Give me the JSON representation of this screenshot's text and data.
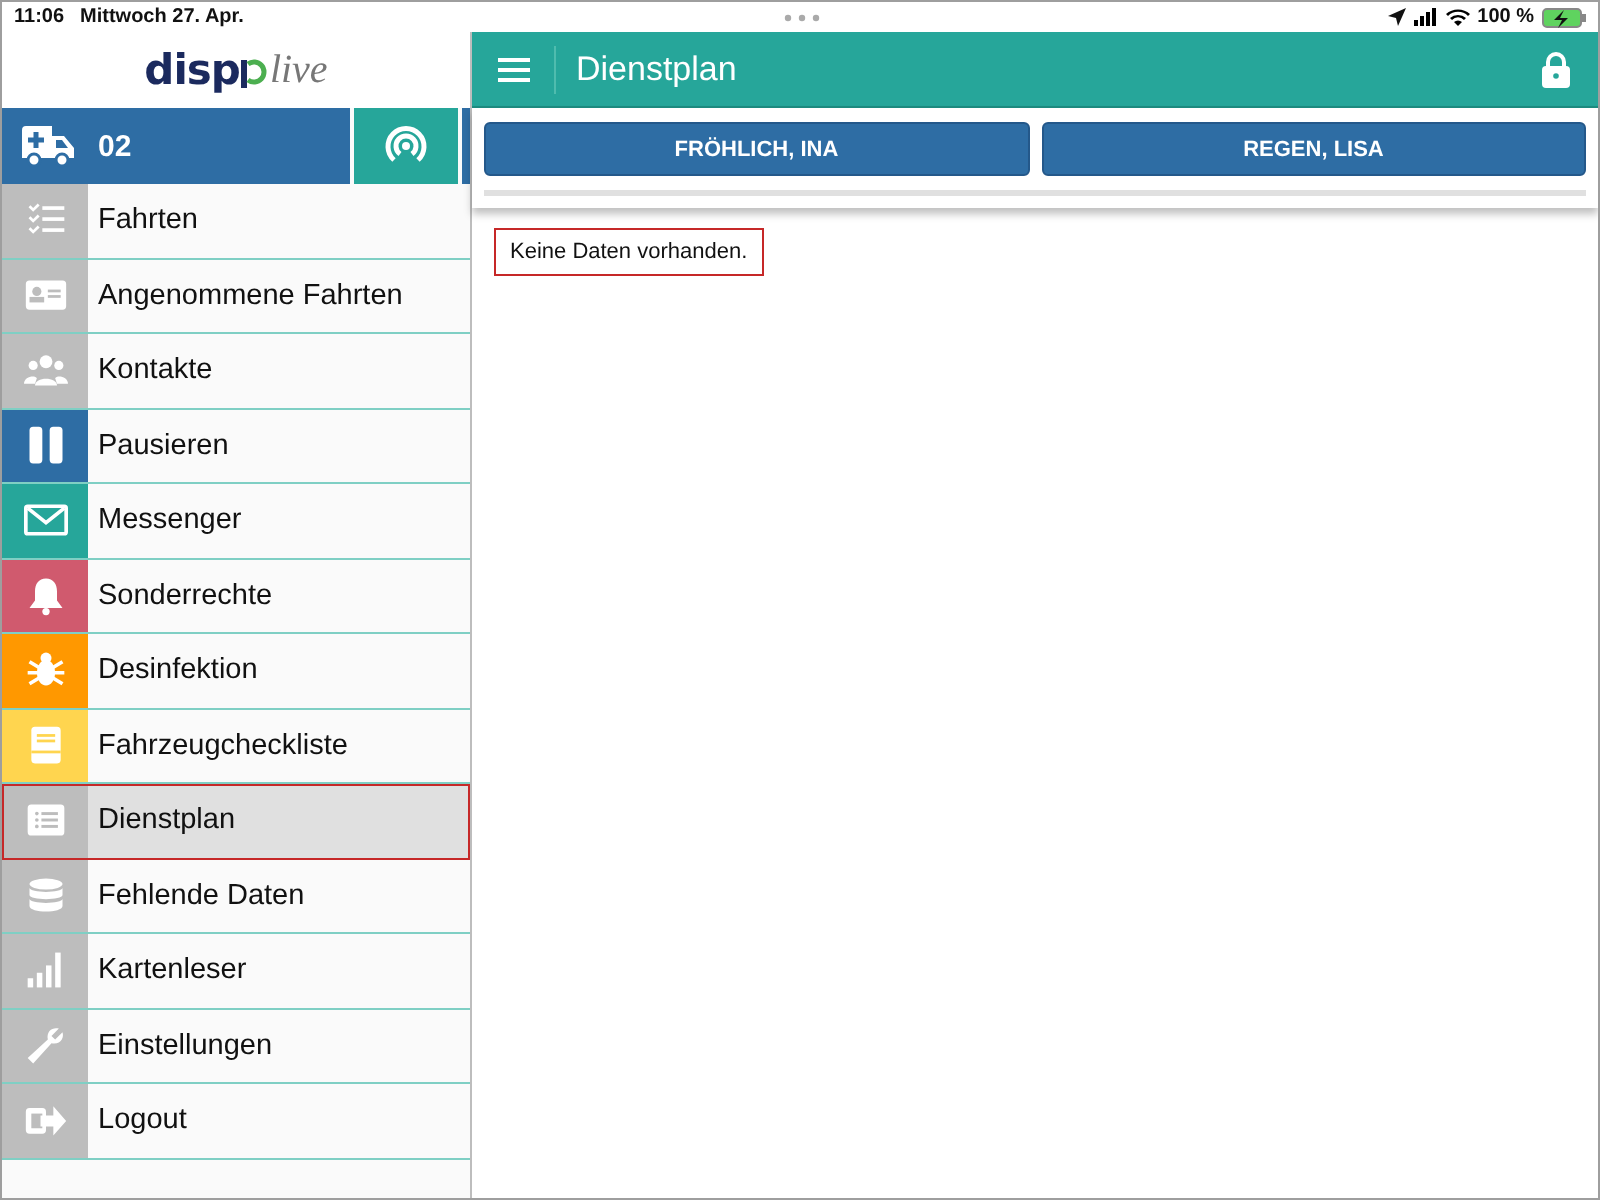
{
  "status_bar": {
    "time": "11:06",
    "date": "Mittwoch 27. Apr.",
    "battery": "100 %"
  },
  "logo": {
    "start": "disp",
    "end": "live"
  },
  "vehicle": {
    "number": "02"
  },
  "sidebar": {
    "items": [
      {
        "label": "Fahrten",
        "color": "#bdbdbd",
        "selected": false
      },
      {
        "label": "Angenommene Fahrten",
        "color": "#bdbdbd",
        "selected": false
      },
      {
        "label": "Kontakte",
        "color": "#bdbdbd",
        "selected": false
      },
      {
        "label": "Pausieren",
        "color": "#2e6da4",
        "selected": false
      },
      {
        "label": "Messenger",
        "color": "#26a69a",
        "selected": false
      },
      {
        "label": "Sonderrechte",
        "color": "#d05a6e",
        "selected": false
      },
      {
        "label": "Desinfektion",
        "color": "#ff9800",
        "selected": false
      },
      {
        "label": "Fahrzeugcheckliste",
        "color": "#ffd54f",
        "selected": false
      },
      {
        "label": "Dienstplan",
        "color": "#bdbdbd",
        "selected": true
      },
      {
        "label": "Fehlende Daten",
        "color": "#bdbdbd",
        "selected": false
      },
      {
        "label": "Kartenleser",
        "color": "#bdbdbd",
        "selected": false
      },
      {
        "label": "Einstellungen",
        "color": "#bdbdbd",
        "selected": false
      },
      {
        "label": "Logout",
        "color": "#bdbdbd",
        "selected": false
      }
    ]
  },
  "header": {
    "title": "Dienstplan"
  },
  "staff_buttons": [
    "FRÖHLICH, INA",
    "REGEN, LISA"
  ],
  "message": "Keine Daten vorhanden."
}
